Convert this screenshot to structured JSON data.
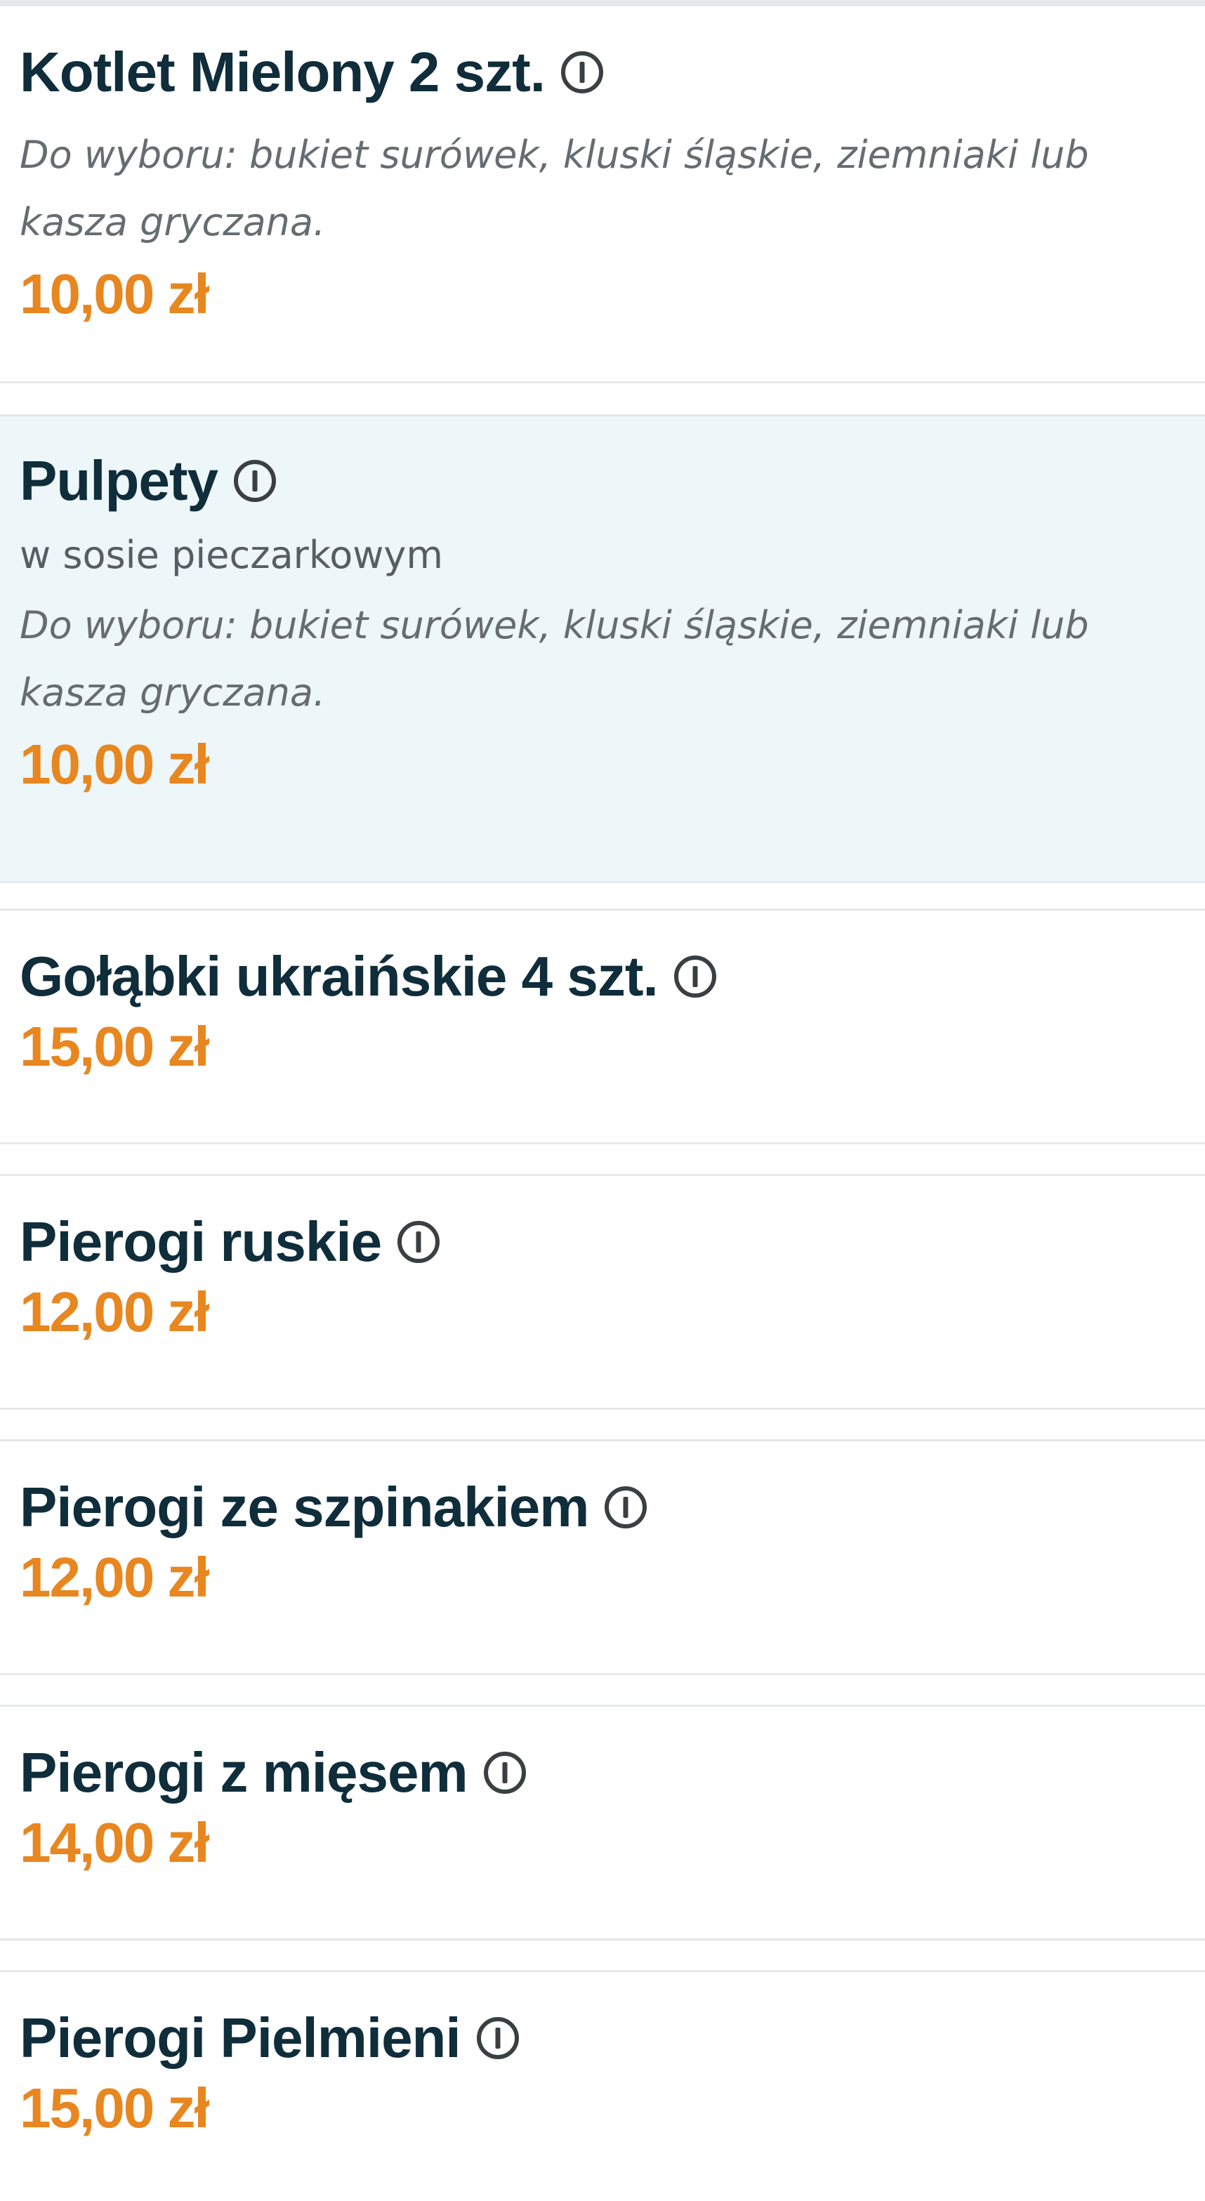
{
  "colors": {
    "title": "#0f2d3a",
    "price": "#e8861f",
    "description": "#666c70",
    "highlight_bg": "#edf6f9",
    "divider": "#e6e9eb"
  },
  "menu_items": [
    {
      "name": "Kotlet Mielony 2 szt.",
      "description": "Do wyboru: bukiet surówek, kluski śląskie, ziemniaki lub kasza gryczana.",
      "price": "10,00 zł",
      "icon": "info-icon"
    },
    {
      "name": "Pulpety",
      "subtitle": "w sosie pieczarkowym",
      "description": "Do wyboru: bukiet surówek, kluski śląskie, ziemniaki lub kasza gryczana.",
      "price": "10,00 zł",
      "icon": "info-icon",
      "highlighted": true
    },
    {
      "name": "Gołąbki ukraińskie 4 szt.",
      "price": "15,00 zł",
      "icon": "info-icon"
    },
    {
      "name": "Pierogi ruskie",
      "price": "12,00 zł",
      "icon": "info-icon"
    },
    {
      "name": "Pierogi ze szpinakiem",
      "price": "12,00 zł",
      "icon": "info-icon"
    },
    {
      "name": "Pierogi z mięsem",
      "price": "14,00 zł",
      "icon": "info-icon"
    },
    {
      "name": "Pierogi Pielmieni",
      "price": "15,00 zł",
      "icon": "info-icon"
    }
  ]
}
